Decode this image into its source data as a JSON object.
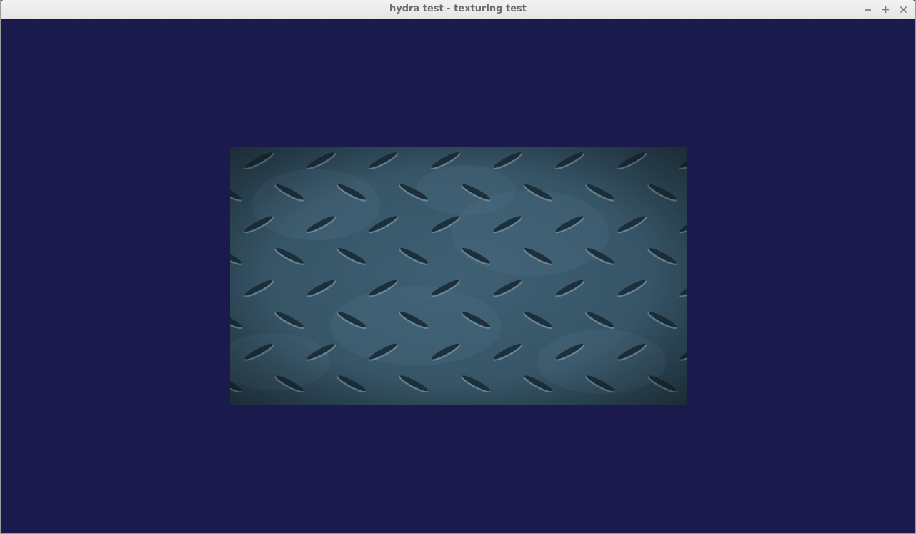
{
  "window": {
    "title": "hydra test - texturing test",
    "controls": {
      "minimize_icon": "minimize-icon",
      "maximize_icon": "maximize-icon",
      "close_icon": "close-icon"
    }
  },
  "scene": {
    "clear_color": "#1b1a4c",
    "texture": "diamond-plate-steel",
    "texture_base_color": "#3b5a6d",
    "texture_groove_color": "#1d2f3a",
    "texture_highlight_color": "#6f8fa3"
  }
}
